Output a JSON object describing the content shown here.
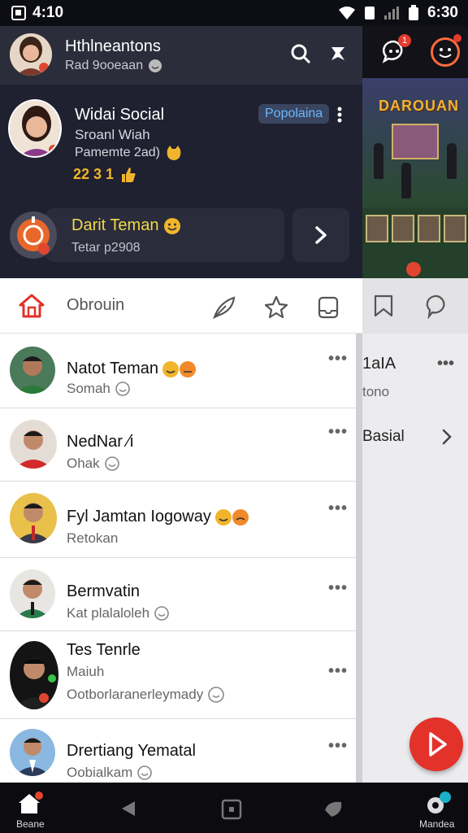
{
  "status_bar": {
    "time": "4:10",
    "battery_time": "6:30"
  },
  "header": {
    "title": "Hthlneantons",
    "subtitle": "Rad 9ooeaan",
    "chat_badge": "1"
  },
  "game_banner": {
    "title": "DAROUAN"
  },
  "profile": {
    "name": "Widai Social",
    "tag": "Popolaina",
    "line1": "Sroanl Wiah",
    "line2": "Pamemte 2ad)",
    "stats": "22 3 1"
  },
  "invite": {
    "title": "Darit Teman",
    "subtitle": "Tetar p2908"
  },
  "tabs": {
    "active_label": "Obrouin"
  },
  "chats": [
    {
      "name": "Natot Teman",
      "message": "Somah",
      "extra": ""
    },
    {
      "name": "NedNar ⁄i",
      "message": "Ohak",
      "extra": ""
    },
    {
      "name": "Fyl Jamtan Iogoway",
      "message": "Retokan",
      "extra": ""
    },
    {
      "name": "Bermvatin",
      "message": "Kat plalaloleh",
      "extra": ""
    },
    {
      "name": "Tes Tenrle",
      "message": "Maiuh",
      "extra": "Ootborlaranerleymady"
    },
    {
      "name": "Drertiang Yematal",
      "message": "Oobialkam",
      "extra": ""
    }
  ],
  "right_list": {
    "title": "1aIA",
    "subtitle": "tono",
    "item": "Basial"
  },
  "nav": {
    "home_label": "Beane",
    "monitor_label": "Mandea"
  },
  "colors": {
    "accent": "#e2322a",
    "header_bg": "#2c2d3b",
    "card_bg": "#1f2030",
    "highlight": "#f0d84a"
  }
}
